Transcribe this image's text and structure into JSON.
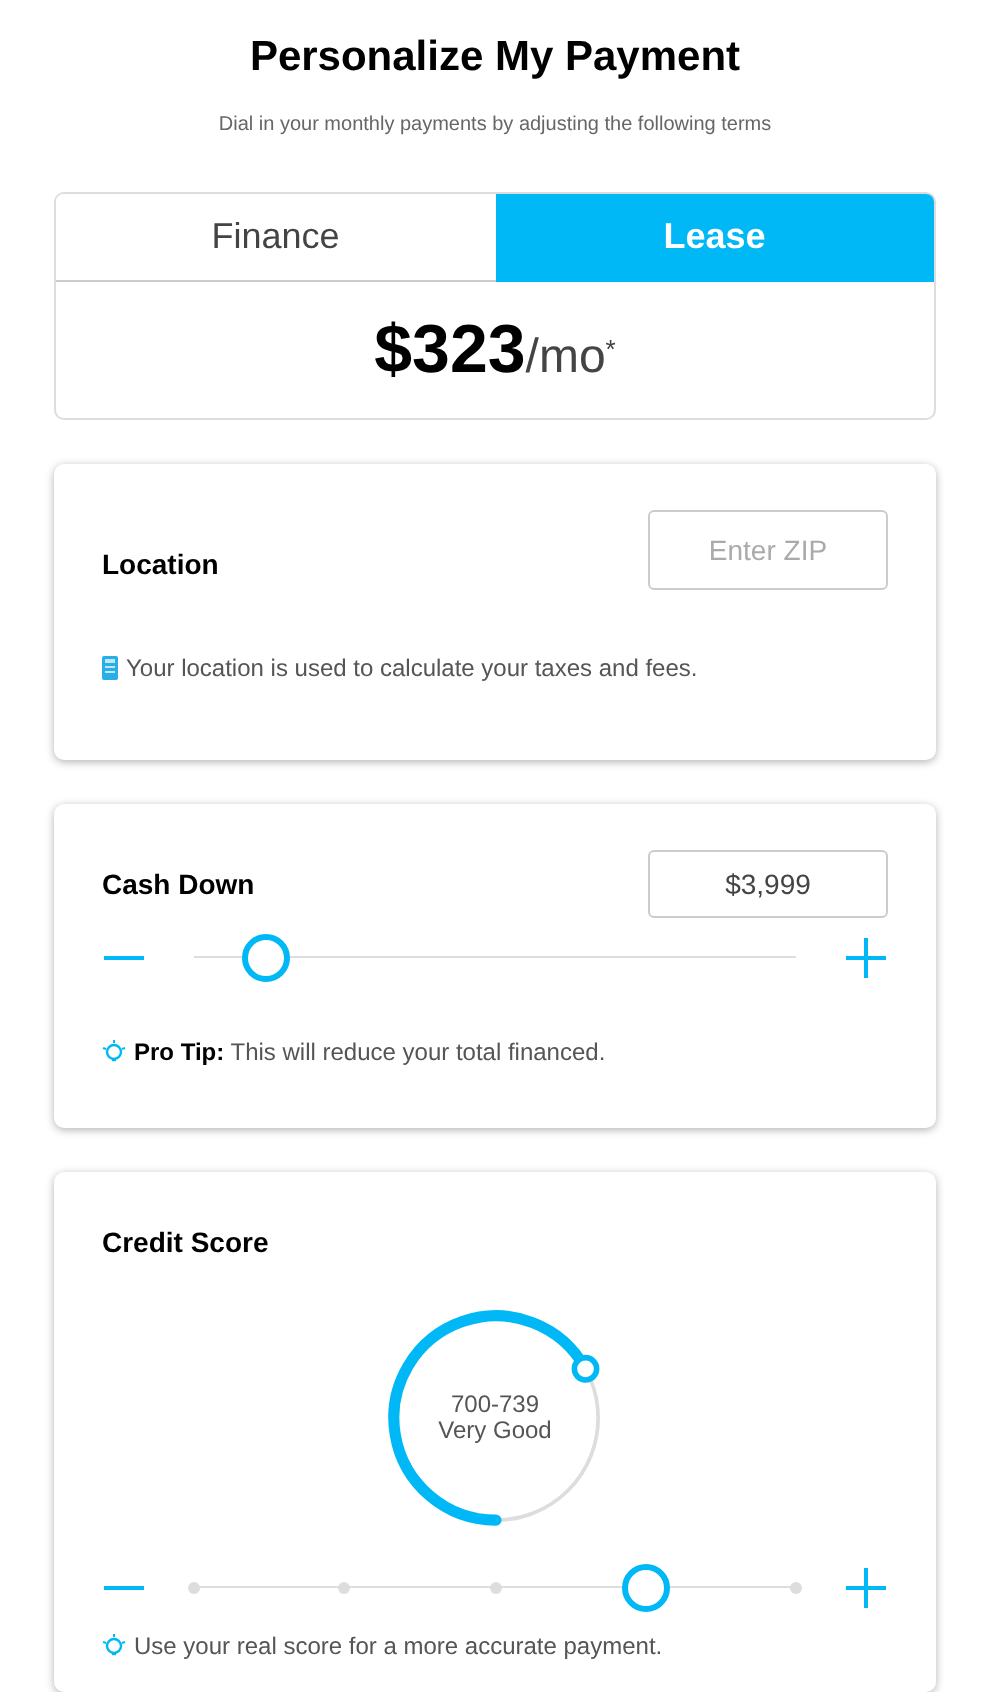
{
  "title": "Personalize My Payment",
  "subtitle": "Dial in your monthly payments by adjusting the following terms",
  "tabs": [
    {
      "label": "Finance",
      "selected": false
    },
    {
      "label": "Lease",
      "selected": true
    }
  ],
  "payment": {
    "amount": "$323",
    "unit": "/mo",
    "footnote": "*"
  },
  "sections": [
    {
      "kind": "location",
      "title": "Location",
      "field": {
        "placeholder": "Enter ZIP"
      },
      "note": "Your location is used to calculate your taxes and fees."
    },
    {
      "kind": "slider",
      "title": "Cash Down",
      "field": {
        "value": "$3,999"
      },
      "level": 0.12,
      "note": "**Pro Tip:** This will reduce your total financed."
    },
    {
      "kind": "gauge",
      "title": "Credit Score",
      "gauge": {
        "range": "700-739",
        "rating": "Very Good"
      },
      "level": 0.75,
      "note": "Use your real score for a more accurate payment."
    }
  ]
}
